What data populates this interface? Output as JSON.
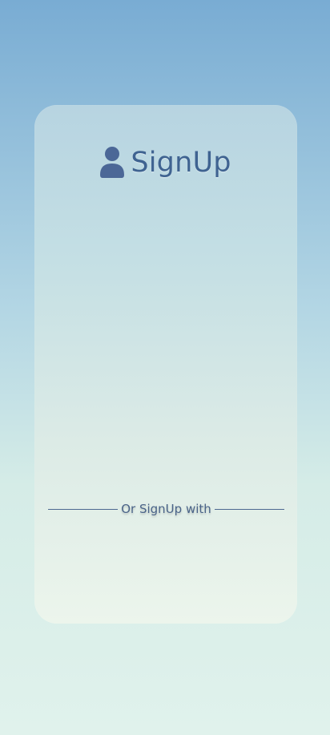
{
  "screen": {
    "theme": {
      "background_top": "#79acd3",
      "background_bottom": "#e0f2ec",
      "accent": "#3f6391"
    },
    "card": {
      "header": {
        "icon": "user-icon",
        "title": "SignUp"
      },
      "divider": {
        "label": "Or SignUp with"
      }
    }
  }
}
